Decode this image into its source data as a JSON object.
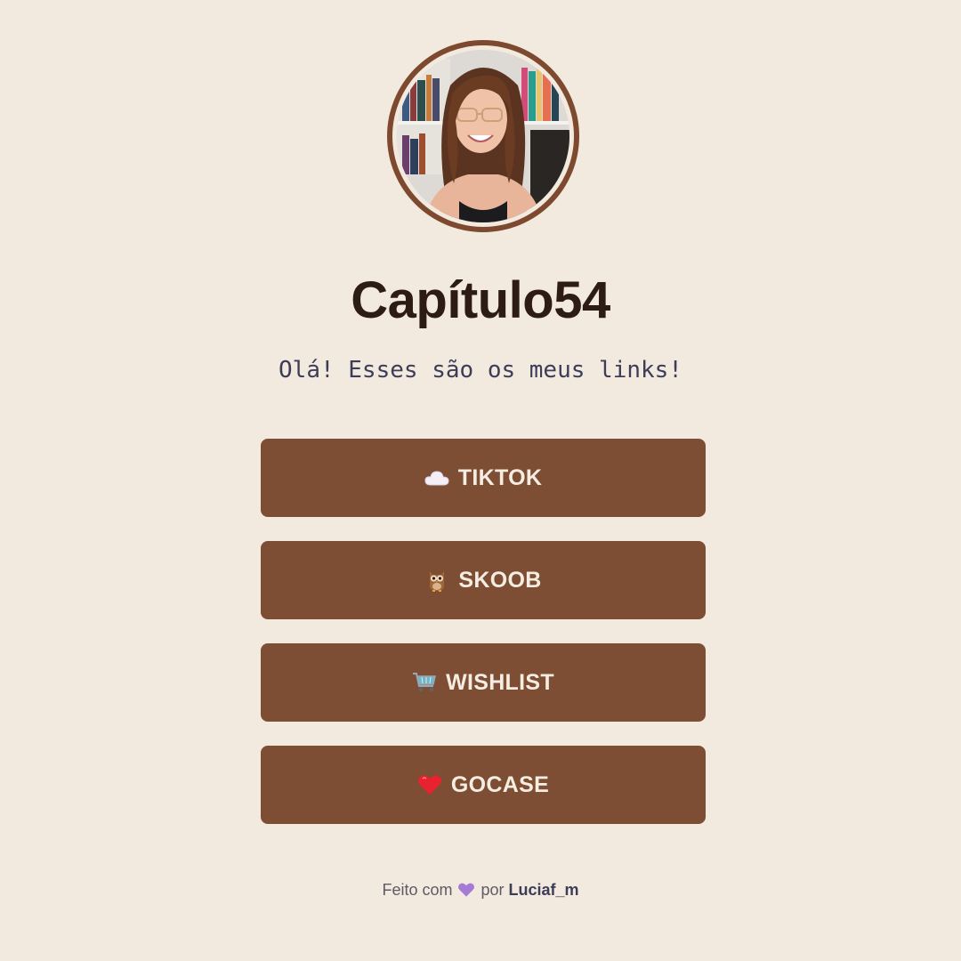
{
  "profile": {
    "avatar_icon": "profile-photo",
    "title": "Capítulo54",
    "subtitle": "Olá! Esses são os meus links!"
  },
  "links": [
    {
      "icon": "cloud-icon",
      "label": "TIKTOK"
    },
    {
      "icon": "owl-icon",
      "label": "SKOOB"
    },
    {
      "icon": "cart-icon",
      "label": "WISHLIST"
    },
    {
      "icon": "heart-icon",
      "label": "GOCASE"
    }
  ],
  "footer": {
    "made_with": "Feito com",
    "heart_icon": "purple-heart-icon",
    "by": "por",
    "author": "Luciaf_m"
  },
  "colors": {
    "background": "#f2e9df",
    "button": "#7d4e33",
    "button_text": "#f5ece2",
    "title": "#2c1c14",
    "subtitle": "#3d3d58"
  }
}
